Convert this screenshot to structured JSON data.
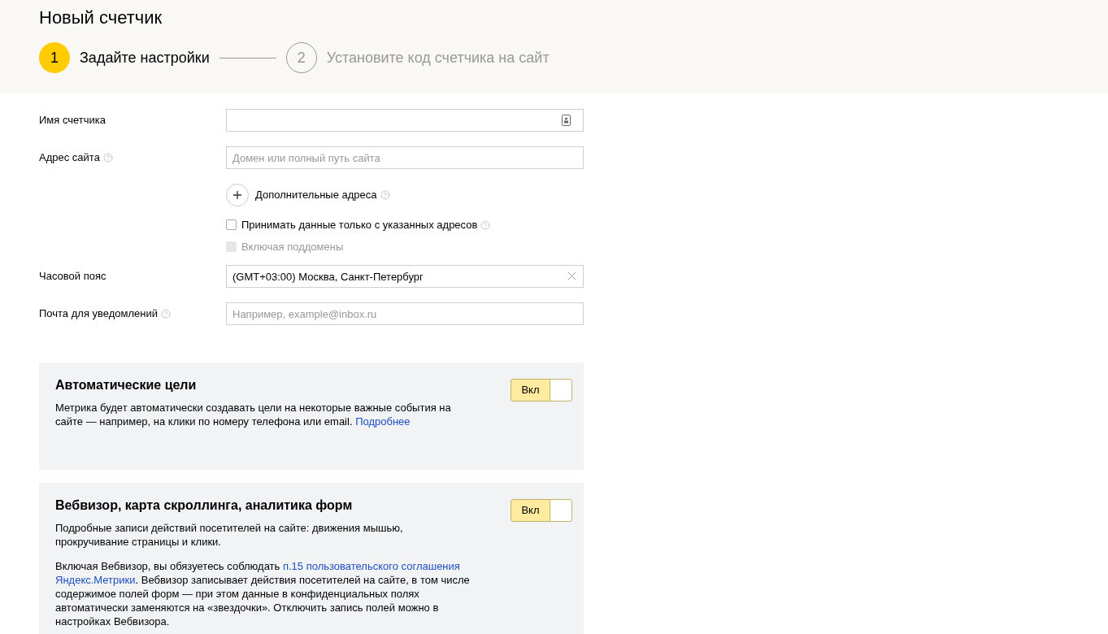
{
  "page_title": "Новый счетчик",
  "steps": [
    {
      "number": "1",
      "label": "Задайте настройки",
      "selected": true
    },
    {
      "number": "2",
      "label": "Установите код счетчика на сайт",
      "selected": false
    }
  ],
  "form": [
    {
      "kind": "input",
      "label": "Имя счетчика",
      "help": false,
      "contact_button": true
    },
    {
      "kind": "input",
      "label": "Адрес сайта",
      "help": true,
      "placeholder": "Домен или полный путь сайта"
    },
    {
      "kind": "add",
      "label": "Дополнительные адреса",
      "help": true
    },
    {
      "kind": "checkbox",
      "label": "Принимать данные только с указанных адресов",
      "help": true,
      "checked": false,
      "disabled": false
    },
    {
      "kind": "checkbox",
      "label": "Включая поддомены",
      "help": false,
      "checked": false,
      "disabled": true
    },
    {
      "kind": "input",
      "label": "Часовой пояс",
      "help": false,
      "value": "(GMT+03:00) Москва, Санкт-Петербург",
      "clear_button": true
    },
    {
      "kind": "input",
      "label": "Почта для уведомлений",
      "help": true,
      "placeholder": "Например, example@inbox.ru"
    }
  ],
  "cards": [
    {
      "title": "Автоматические цели",
      "toggle": {
        "label": "Вкл",
        "on": true
      },
      "paragraphs": [
        [
          {
            "kind": "text",
            "text": "Метрика будет автоматически создавать цели на некоторые важные события на сайте — например, на клики по номеру телефона или email. "
          },
          {
            "kind": "link",
            "text": "Подробнее"
          }
        ]
      ]
    },
    {
      "title": "Вебвизор, карта скроллинга, аналитика форм",
      "toggle": {
        "label": "Вкл",
        "on": true
      },
      "paragraphs": [
        [
          {
            "kind": "text",
            "text": "Подробные записи действий посетителей на сайте: движения мышью, прокручивание страницы и клики."
          }
        ],
        [
          {
            "kind": "text",
            "text": "Включая Вебвизор, вы обязуетесь соблюдать "
          },
          {
            "kind": "link",
            "text": "п.15 пользовательского соглашения"
          },
          {
            "kind": "link",
            "text": "Яндекс.Метрики"
          },
          {
            "kind": "text",
            "text": ". Вебвизор записывает действия посетителей на сайте, в том числе содержимое полей форм — при этом данные в конфиденциальных полях автоматически заменяются на «звездочки». Отключить запись полей можно в настройках Вебвизора."
          }
        ]
      ]
    }
  ]
}
